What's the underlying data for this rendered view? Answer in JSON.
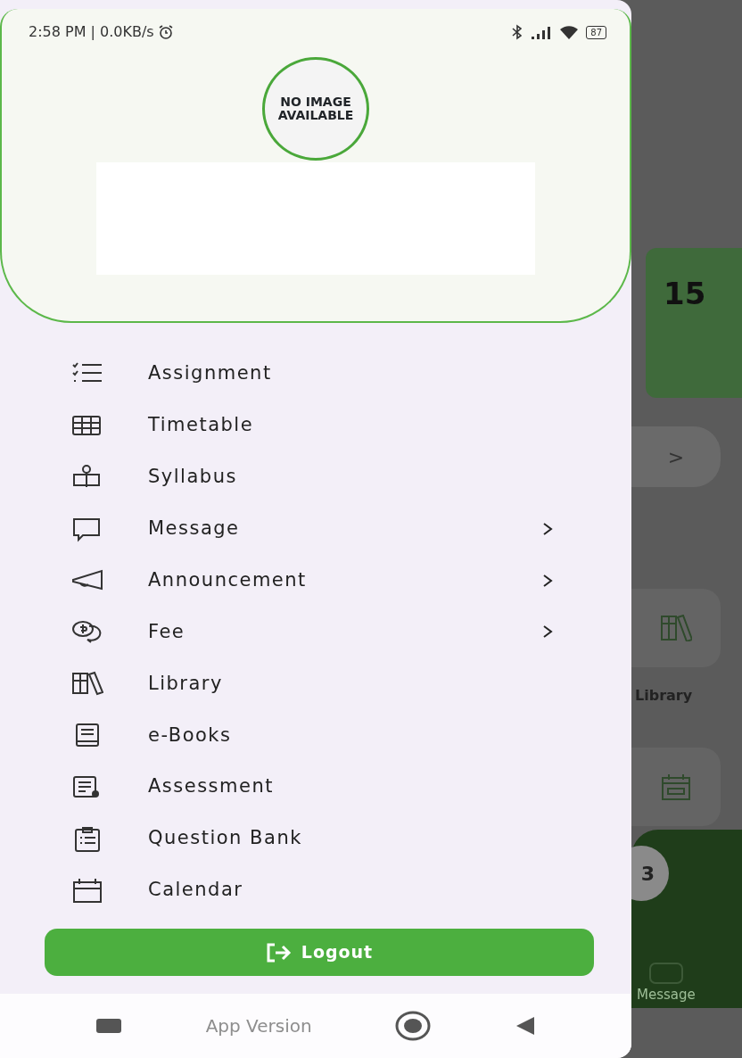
{
  "status_bar": {
    "time": "2:58 PM | 0.0KB/s",
    "battery": "87"
  },
  "profile": {
    "avatar_text": "NO IMAGE AVAILABLE"
  },
  "menu": [
    {
      "label": "Assignment",
      "kind": "checklist",
      "has_submenu": false
    },
    {
      "label": "Timetable",
      "kind": "grid",
      "has_submenu": false
    },
    {
      "label": "Syllabus",
      "kind": "syllabus",
      "has_submenu": false
    },
    {
      "label": "Message",
      "kind": "message",
      "has_submenu": true
    },
    {
      "label": "Announcement",
      "kind": "megaphone",
      "has_submenu": true
    },
    {
      "label": "Fee",
      "kind": "fee",
      "has_submenu": true
    },
    {
      "label": "Library",
      "kind": "books",
      "has_submenu": false
    },
    {
      "label": "e-Books",
      "kind": "ebook",
      "has_submenu": false
    },
    {
      "label": "Assessment",
      "kind": "assessment",
      "has_submenu": false
    },
    {
      "label": "Question Bank",
      "kind": "clipboard",
      "has_submenu": false
    },
    {
      "label": "Calendar",
      "kind": "calendar",
      "has_submenu": false
    }
  ],
  "logout": {
    "label": "Logout"
  },
  "app_version": "App Version",
  "background_screen": {
    "count": "15",
    "chevron": ">",
    "tile_label": "Library",
    "badge": "3",
    "nav_label": "Message"
  }
}
